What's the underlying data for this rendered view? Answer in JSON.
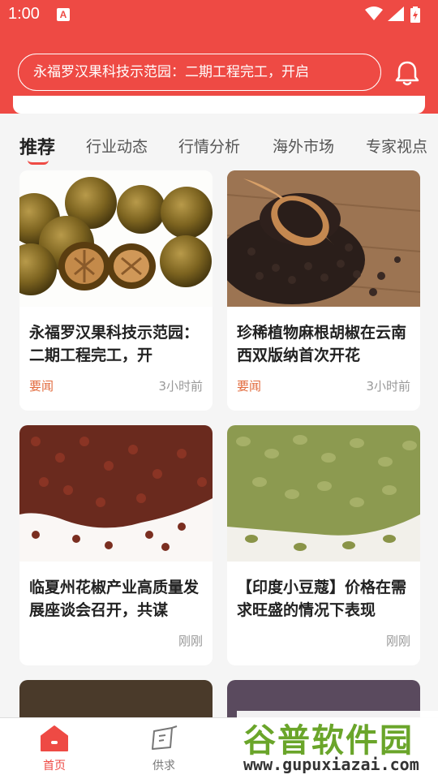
{
  "status_bar": {
    "time": "1:00",
    "app_icon_letter": "A"
  },
  "header": {
    "search_text": "永福罗汉果科技示范园：二期工程完工，开启"
  },
  "tabs": [
    {
      "label": "推荐",
      "active": true
    },
    {
      "label": "行业动态"
    },
    {
      "label": "行情分析"
    },
    {
      "label": "海外市场"
    },
    {
      "label": "专家视点"
    }
  ],
  "cards": [
    {
      "title": "永福罗汉果科技示范园：二期工程完工，开",
      "tag": "要闻",
      "time": "3小时前",
      "image": "luo-han-guo-fruit"
    },
    {
      "title": "珍稀植物麻根胡椒在云南西双版纳首次开花",
      "tag": "要闻",
      "time": "3小时前",
      "image": "black-pepper-spoon"
    },
    {
      "title": "临夏州花椒产业高质量发展座谈会召开，共谋",
      "tag": "",
      "time": "刚刚",
      "image": "sichuan-pepper"
    },
    {
      "title": "【印度小豆蔻】价格在需求旺盛的情况下表现",
      "tag": "",
      "time": "刚刚",
      "image": "green-cardamom"
    }
  ],
  "bottom_nav": [
    {
      "label": "首页",
      "icon": "home-icon",
      "active": true
    },
    {
      "label": "供求",
      "icon": "supply-icon"
    }
  ],
  "watermark": {
    "text": "谷普软件园",
    "url": "www.gupuxiazai.com"
  },
  "colors": {
    "accent": "#ee4a44",
    "tag": "#e26a3c",
    "watermark_green": "#6aa52a"
  }
}
